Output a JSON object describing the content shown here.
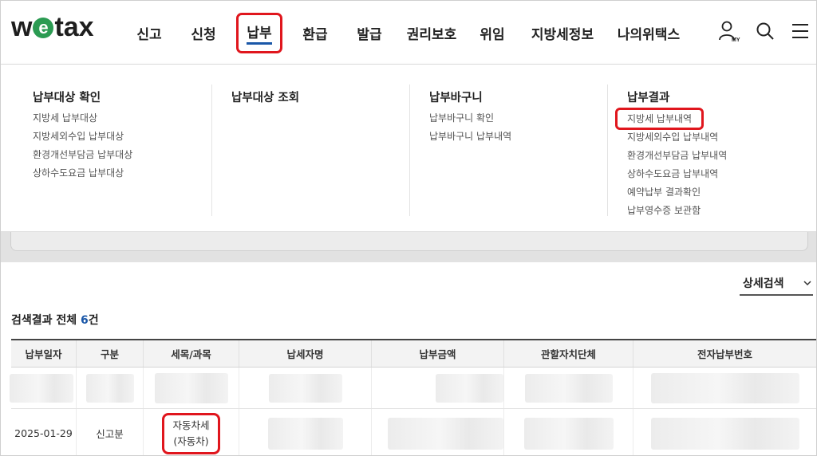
{
  "header": {
    "logo_parts": [
      "w",
      "e",
      "tax"
    ],
    "nav": [
      {
        "label": "신고"
      },
      {
        "label": "신청"
      },
      {
        "label": "납부",
        "active": true
      },
      {
        "label": "환급"
      },
      {
        "label": "발급"
      },
      {
        "label": "권리보호"
      },
      {
        "label": "위임"
      },
      {
        "label": "지방세정보"
      },
      {
        "label": "나의위택스"
      }
    ],
    "my_label": "MY",
    "icons": [
      "user-my-icon",
      "search-icon",
      "menu-icon"
    ]
  },
  "mega_menu": {
    "columns": [
      {
        "title": "납부대상 확인",
        "items": [
          "지방세 납부대상",
          "지방세외수입 납부대상",
          "환경개선부담금 납부대상",
          "상하수도요금 납부대상"
        ]
      },
      {
        "title": "납부대상 조회",
        "items": []
      },
      {
        "title": "납부바구니",
        "items": [
          "납부바구니 확인",
          "납부바구니 납부내역"
        ]
      },
      {
        "title": "납부결과",
        "items": [
          "지방세 납부내역",
          "지방세외수입 납부내역",
          "환경개선부담금 납부내역",
          "상하수도요금 납부내역",
          "예약납부 결과확인",
          "납부영수증 보관함"
        ]
      }
    ],
    "highlighted_item": "지방세 납부내역"
  },
  "content": {
    "detail_search_label": "상세검색",
    "result_prefix": "검색결과 전체 ",
    "result_count": "6",
    "result_suffix": "건",
    "table": {
      "headers": [
        "납부일자",
        "구분",
        "세목/과목",
        "납세자명",
        "납부금액",
        "관할자치단체",
        "전자납부번호"
      ],
      "rows": [
        {
          "date": "",
          "type": "",
          "tax_line1": "",
          "tax_line2": "",
          "blurred": true
        },
        {
          "date": "2025-01-29",
          "type": "신고분",
          "tax_line1": "자동차세",
          "tax_line2": "(자동차)",
          "blurred": false
        }
      ]
    }
  },
  "colors": {
    "highlight_red": "#e0161d",
    "accent_blue": "#1a57a8",
    "logo_green": "#2b9b52"
  }
}
